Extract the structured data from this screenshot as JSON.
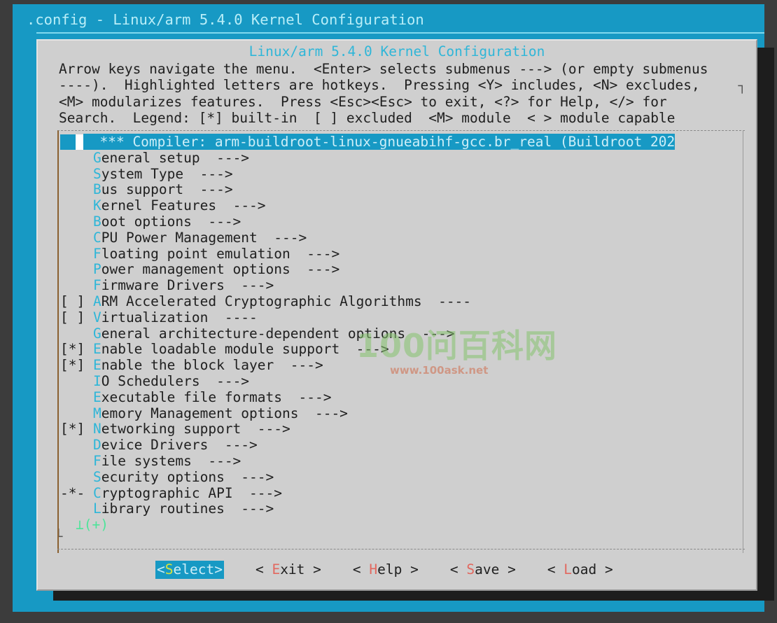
{
  "window": {
    "title": ".config - Linux/arm 5.4.0 Kernel Configuration"
  },
  "dialog": {
    "title": "Linux/arm 5.4.0 Kernel Configuration",
    "help_text": "Arrow keys navigate the menu.  <Enter> selects submenus ---> (or empty submenus\n----).  Highlighted letters are hotkeys.  Pressing <Y> includes, <N> excludes,\n<M> modularizes features.  Press <Esc><Esc> to exit, <?> for Help, </> for\nSearch.  Legend: [*] built-in  [ ] excluded  <M> module  < > module capable",
    "scroll_indicator": "⊥(+)"
  },
  "colors": {
    "screen_bg": "#1799c4",
    "dialog_bg": "#cfcfcf",
    "highlight_bg": "#1799c4",
    "hotkey": "#2fb6d8",
    "button_hotkey": "#e2685f",
    "active_button_hotkey": "#d8e23a",
    "scroll_green": "#4ee49a",
    "frame_dark": "#3c3c3c",
    "shadow": "#1d1d1d"
  },
  "menu": {
    "items": [
      {
        "prefix": "    ",
        "hot": "",
        "text": "*** Compiler: arm-buildroot-linux-gnueabihf-gcc.br_real (Buildroot 202",
        "arrow": "",
        "selected": true
      },
      {
        "prefix": "    ",
        "hot": "G",
        "text": "eneral setup",
        "arrow": "  --->",
        "selected": false
      },
      {
        "prefix": "    ",
        "hot": "S",
        "text": "ystem Type",
        "arrow": "  --->",
        "selected": false
      },
      {
        "prefix": "    ",
        "hot": "B",
        "text": "us support",
        "arrow": "  --->",
        "selected": false
      },
      {
        "prefix": "    ",
        "hot": "K",
        "text": "ernel Features",
        "arrow": "  --->",
        "selected": false
      },
      {
        "prefix": "    ",
        "hot": "B",
        "text": "oot options",
        "arrow": "  --->",
        "selected": false
      },
      {
        "prefix": "    ",
        "hot": "C",
        "text": "PU Power Management",
        "arrow": "  --->",
        "selected": false
      },
      {
        "prefix": "    ",
        "hot": "F",
        "text": "loating point emulation",
        "arrow": "  --->",
        "selected": false
      },
      {
        "prefix": "    ",
        "hot": "P",
        "text": "ower management options",
        "arrow": "  --->",
        "selected": false
      },
      {
        "prefix": "    ",
        "hot": "F",
        "text": "irmware Drivers",
        "arrow": "  --->",
        "selected": false
      },
      {
        "prefix": "[ ] ",
        "hot": "A",
        "text": "RM Accelerated Cryptographic Algorithms",
        "arrow": "  ----",
        "selected": false
      },
      {
        "prefix": "[ ] ",
        "hot": "V",
        "text": "irtualization",
        "arrow": "  ----",
        "selected": false
      },
      {
        "prefix": "    ",
        "hot": "G",
        "text": "eneral architecture-dependent options",
        "arrow": "  --->",
        "selected": false
      },
      {
        "prefix": "[*] ",
        "hot": "E",
        "text": "nable loadable module support",
        "arrow": "  --->",
        "selected": false
      },
      {
        "prefix": "[*] ",
        "hot": "E",
        "text": "nable the block layer",
        "arrow": "  --->",
        "selected": false
      },
      {
        "prefix": "    ",
        "hot": "I",
        "text": "O Schedulers",
        "arrow": "  --->",
        "selected": false
      },
      {
        "prefix": "    ",
        "hot": "E",
        "text": "xecutable file formats",
        "arrow": "  --->",
        "selected": false
      },
      {
        "prefix": "    ",
        "hot": "M",
        "text": "emory Management options",
        "arrow": "  --->",
        "selected": false
      },
      {
        "prefix": "[*] ",
        "hot": "N",
        "text": "etworking support",
        "arrow": "  --->",
        "selected": false
      },
      {
        "prefix": "    ",
        "hot": "D",
        "text": "evice Drivers",
        "arrow": "  --->",
        "selected": false
      },
      {
        "prefix": "    ",
        "hot": "F",
        "text": "ile systems",
        "arrow": "  --->",
        "selected": false
      },
      {
        "prefix": "    ",
        "hot": "S",
        "text": "ecurity options",
        "arrow": "  --->",
        "selected": false
      },
      {
        "prefix": "-*- ",
        "hot": "C",
        "text": "ryptographic API",
        "arrow": "  --->",
        "selected": false
      },
      {
        "prefix": "    ",
        "hot": "L",
        "text": "ibrary routines",
        "arrow": "  --->",
        "selected": false
      }
    ]
  },
  "buttons": [
    {
      "open": "<",
      "hot": "S",
      "rest": "elect",
      "close": ">",
      "active": true
    },
    {
      "open": "< ",
      "hot": "E",
      "rest": "xit",
      "close": " >",
      "active": false
    },
    {
      "open": "< ",
      "hot": "H",
      "rest": "elp",
      "close": " >",
      "active": false
    },
    {
      "open": "< ",
      "hot": "S",
      "rest": "ave",
      "close": " >",
      "active": false
    },
    {
      "open": "< ",
      "hot": "L",
      "rest": "oad",
      "close": " >",
      "active": false
    }
  ],
  "watermark": {
    "big": "100问百科网",
    "url": "www.100ask.net"
  }
}
